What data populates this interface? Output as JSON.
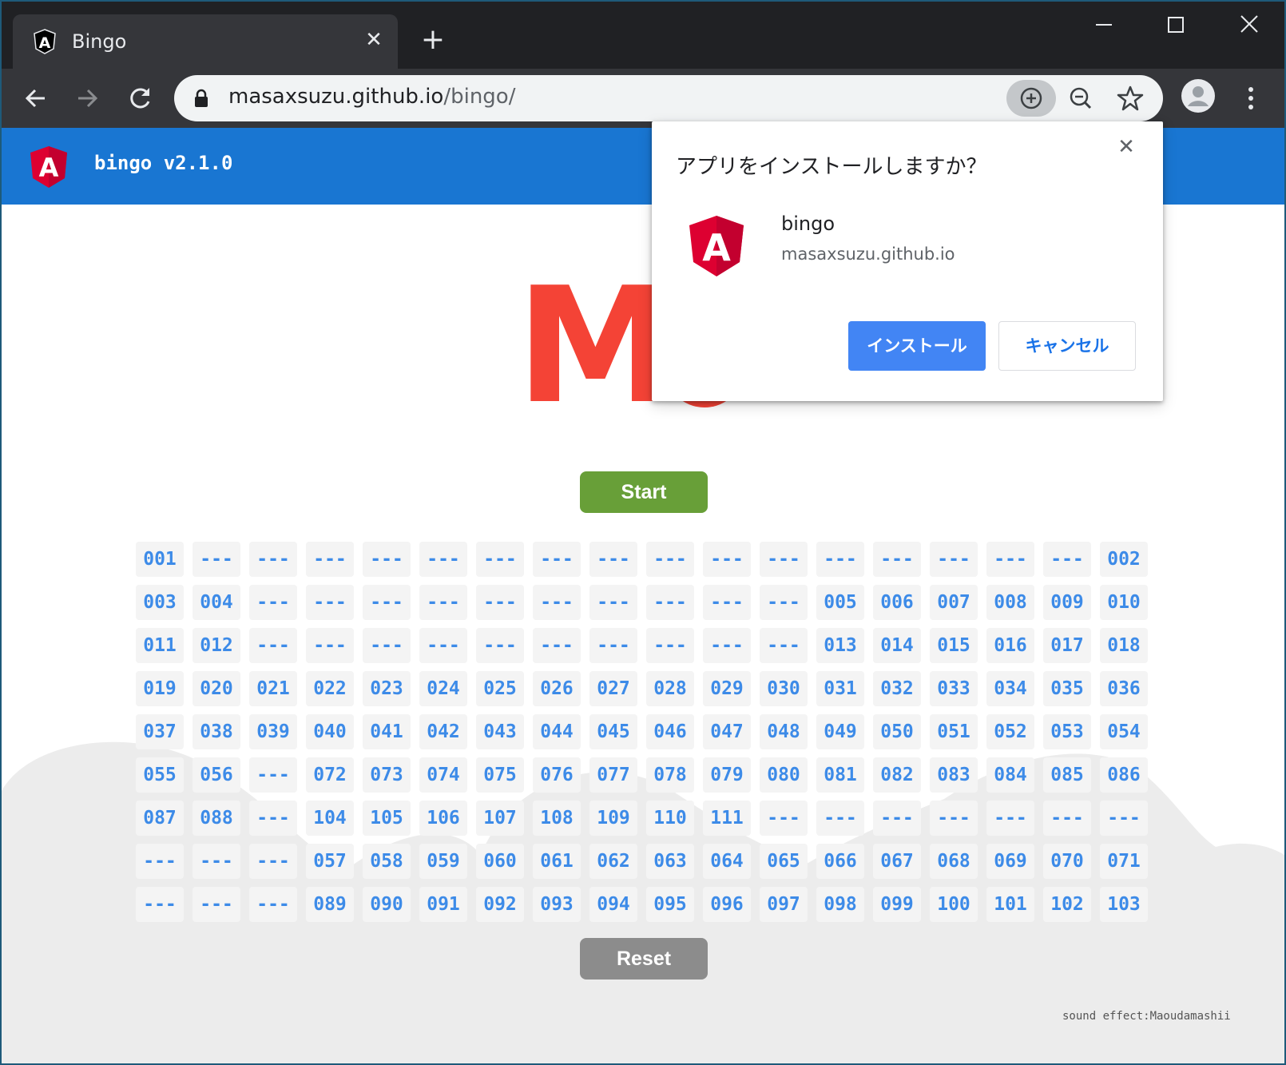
{
  "browser": {
    "tab_title": "Bingo",
    "tab_close": "✕",
    "new_tab": "+",
    "url_host": "masaxsuzu.github.io",
    "url_path": "/bingo/"
  },
  "app": {
    "title": "bingo v2.1.0",
    "current_letter": "M",
    "start_label": "Start",
    "reset_label": "Reset",
    "credit": "sound effect:Maoudamashii",
    "grid": [
      "001",
      "---",
      "---",
      "---",
      "---",
      "---",
      "---",
      "---",
      "---",
      "---",
      "---",
      "---",
      "---",
      "---",
      "---",
      "---",
      "---",
      "002",
      "003",
      "004",
      "---",
      "---",
      "---",
      "---",
      "---",
      "---",
      "---",
      "---",
      "---",
      "---",
      "005",
      "006",
      "007",
      "008",
      "009",
      "010",
      "011",
      "012",
      "---",
      "---",
      "---",
      "---",
      "---",
      "---",
      "---",
      "---",
      "---",
      "---",
      "013",
      "014",
      "015",
      "016",
      "017",
      "018",
      "019",
      "020",
      "021",
      "022",
      "023",
      "024",
      "025",
      "026",
      "027",
      "028",
      "029",
      "030",
      "031",
      "032",
      "033",
      "034",
      "035",
      "036",
      "037",
      "038",
      "039",
      "040",
      "041",
      "042",
      "043",
      "044",
      "045",
      "046",
      "047",
      "048",
      "049",
      "050",
      "051",
      "052",
      "053",
      "054",
      "055",
      "056",
      "---",
      "072",
      "073",
      "074",
      "075",
      "076",
      "077",
      "078",
      "079",
      "080",
      "081",
      "082",
      "083",
      "084",
      "085",
      "086",
      "087",
      "088",
      "---",
      "104",
      "105",
      "106",
      "107",
      "108",
      "109",
      "110",
      "111",
      "---",
      "---",
      "---",
      "---",
      "---",
      "---",
      "---",
      "---",
      "---",
      "---",
      "057",
      "058",
      "059",
      "060",
      "061",
      "062",
      "063",
      "064",
      "065",
      "066",
      "067",
      "068",
      "069",
      "070",
      "071",
      "---",
      "---",
      "---",
      "089",
      "090",
      "091",
      "092",
      "093",
      "094",
      "095",
      "096",
      "097",
      "098",
      "099",
      "100",
      "101",
      "102",
      "103"
    ]
  },
  "dialog": {
    "title": "アプリをインストールしますか？",
    "close": "✕",
    "app_name": "bingo",
    "app_origin": "masaxsuzu.github.io",
    "install_label": "インストール",
    "cancel_label": "キャンセル"
  },
  "colors": {
    "app_bar": "#1976d2",
    "start": "#689f38",
    "reset": "#8c8c8c",
    "number": "#3d8be8",
    "letter": "#f44336",
    "install": "#4285f4"
  },
  "icons": {
    "tab": "angular-logo-icon",
    "nav": [
      "back-arrow-icon",
      "forward-arrow-icon",
      "reload-icon"
    ],
    "omnibox": [
      "lock-icon",
      "install-plus-icon",
      "zoom-out-icon",
      "star-icon"
    ],
    "profile": "profile-avatar-icon",
    "menu": "kebab-menu-icon"
  }
}
